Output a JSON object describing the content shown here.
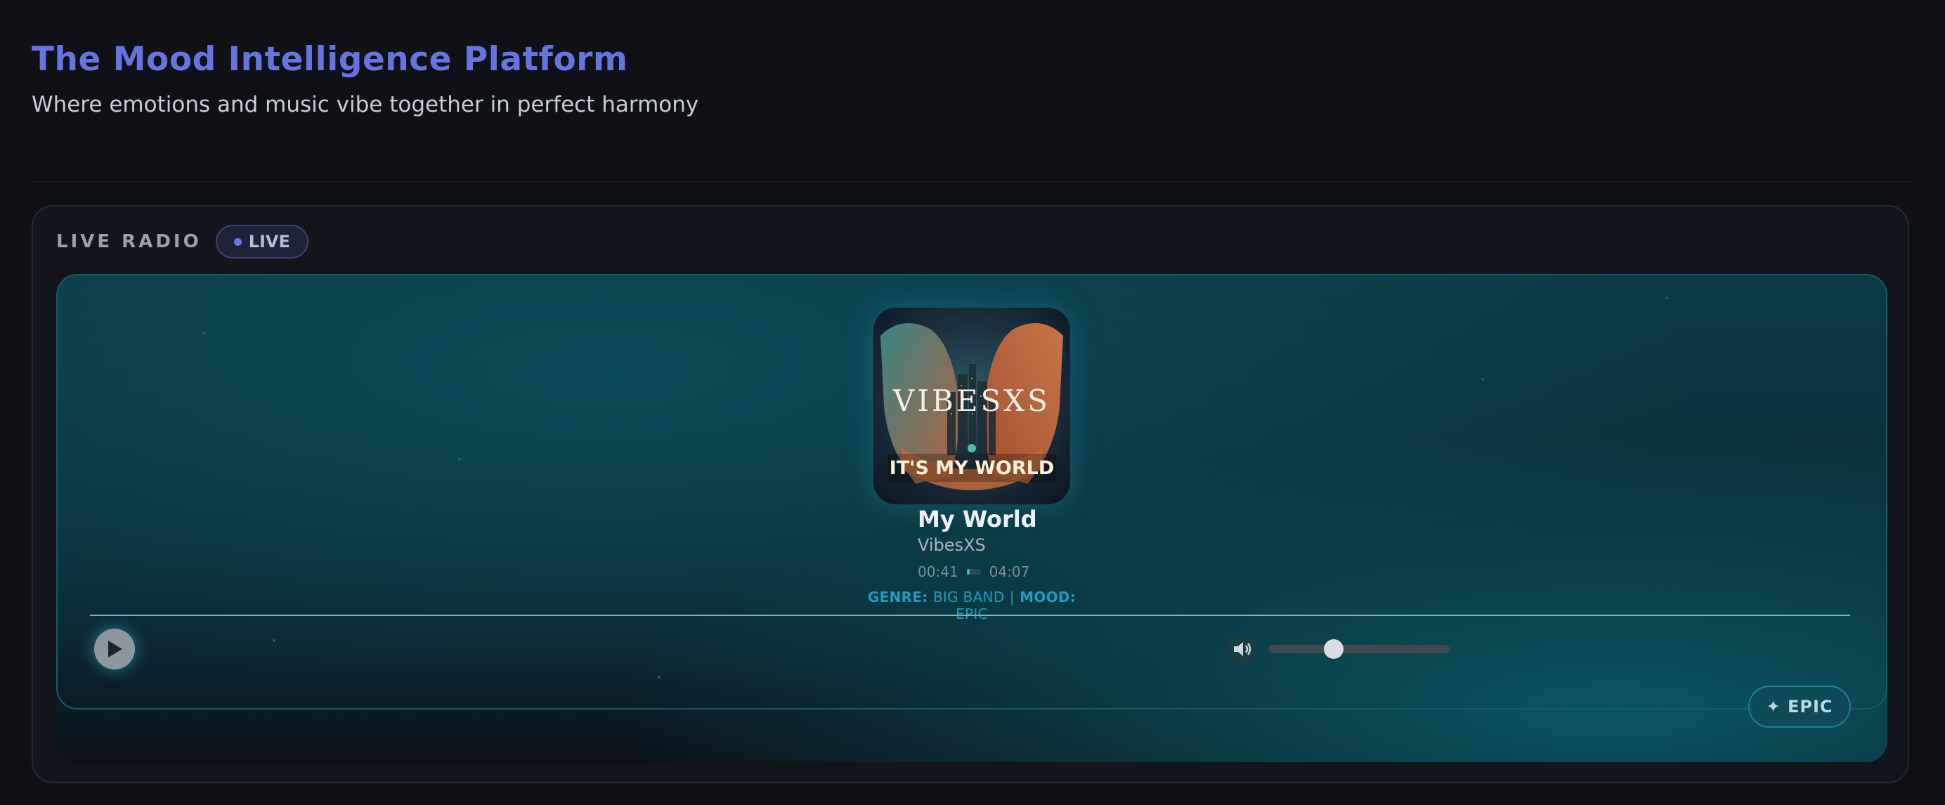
{
  "header": {
    "title": "The Mood Intelligence Platform",
    "subtitle": "Where emotions and music vibe together in perfect harmony"
  },
  "radio": {
    "label": "LIVE RADIO",
    "live_badge": "LIVE"
  },
  "track": {
    "art_brand": "VIBESXS",
    "art_caption": "IT'S MY WORLD",
    "title": "My World",
    "artist": "VibesXS",
    "elapsed": "00:41",
    "duration": "04:07",
    "progress_fraction": 0.166,
    "genre_label": "GENRE:",
    "genre": "BIG BAND",
    "separator": "|",
    "mood_label": "MOOD:",
    "mood": "EPIC"
  },
  "controls": {
    "play_icon": "play-icon",
    "volume_icon": "speaker-icon",
    "volume_fraction": 0.36
  },
  "mood_chip": {
    "label": "✦ EPIC"
  },
  "colors": {
    "accent": "#6674e0",
    "teal": "#1e9bbd",
    "background": "#0f1117"
  }
}
